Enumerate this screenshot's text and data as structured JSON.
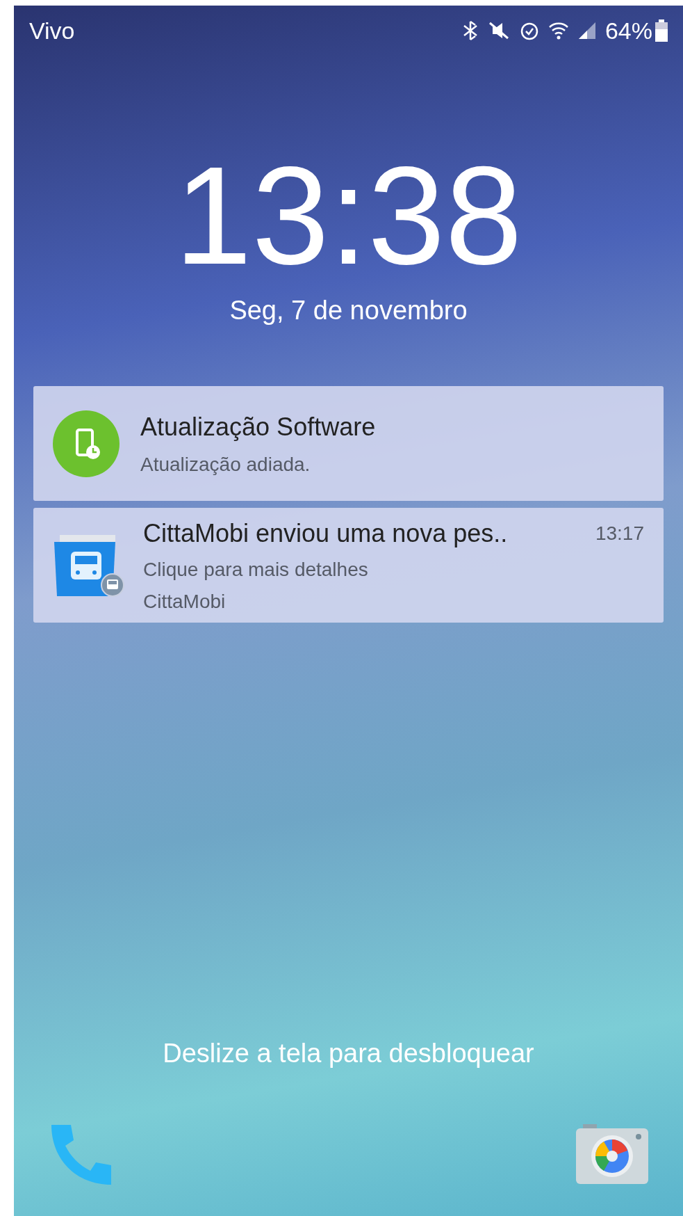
{
  "status_bar": {
    "carrier": "Vivo",
    "battery": "64%"
  },
  "clock": {
    "time": "13:38",
    "date": "Seg, 7 de novembro"
  },
  "notifications": [
    {
      "kind": "update",
      "title": "Atualização Software",
      "text": "Atualização adiada."
    },
    {
      "kind": "app",
      "title": "CittaMobi enviou uma nova pes..",
      "time": "13:17",
      "text": "Clique para mais detalhes",
      "app": "CittaMobi"
    }
  ],
  "unlock_hint": "Deslize a tela para desbloquear"
}
